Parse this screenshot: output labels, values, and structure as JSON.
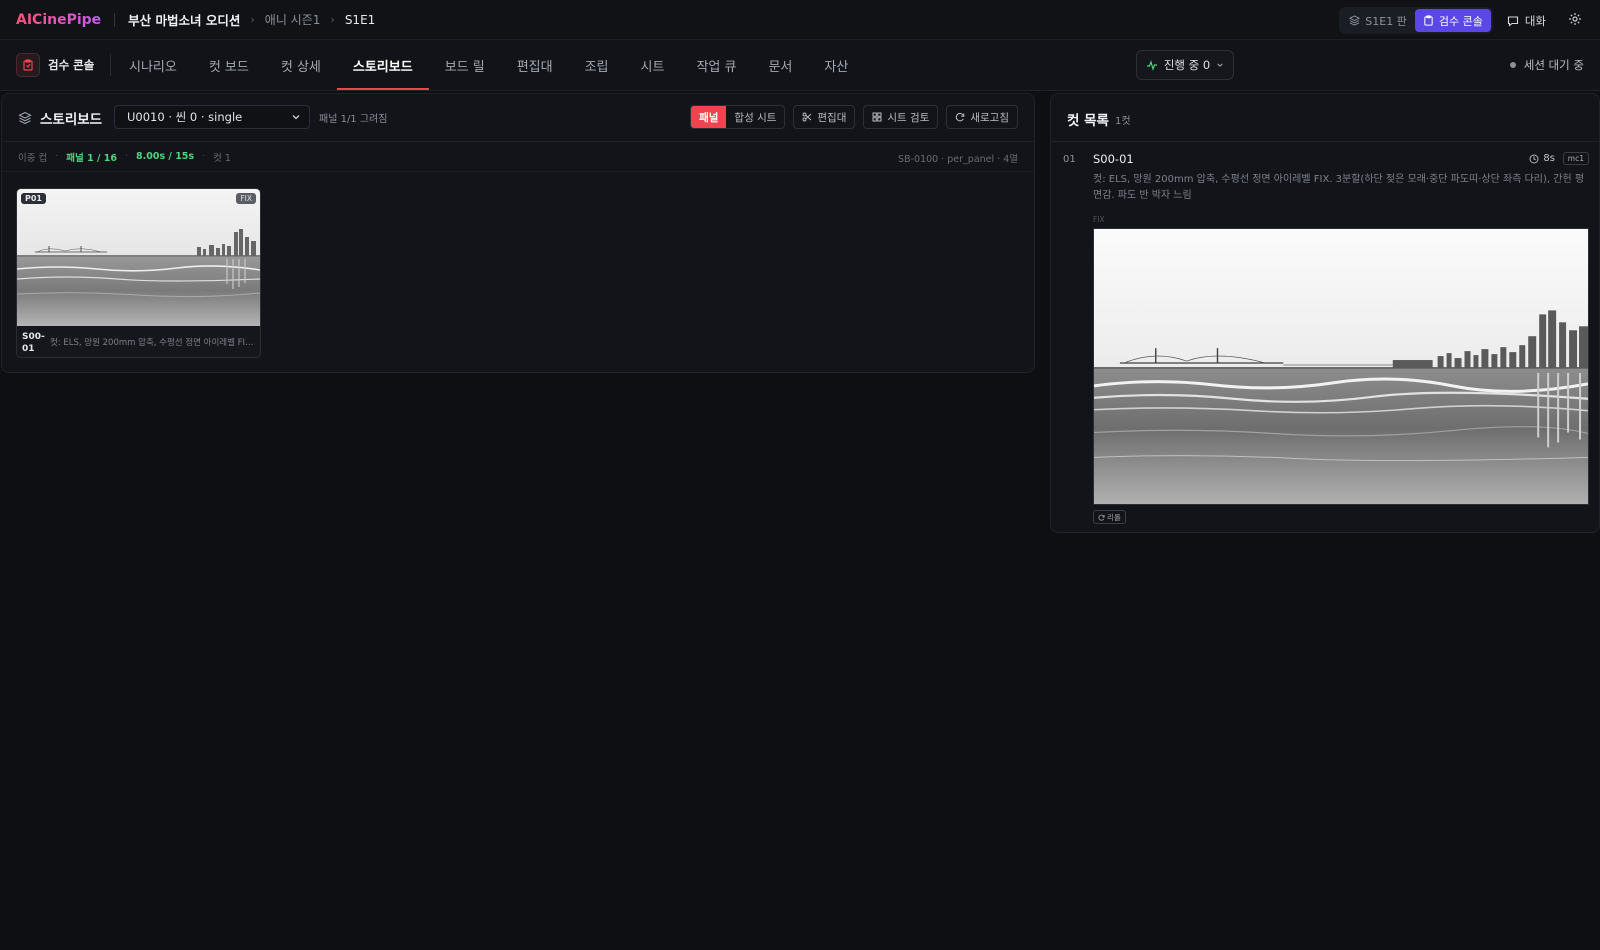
{
  "topbar": {
    "logo": "AICinePipe",
    "project": "부산 마법소녀 오디션",
    "breadcrumb": [
      "애니 시즌1",
      "S1E1"
    ],
    "episode_button": "S1E1 판",
    "review_button": "검수 콘솔",
    "chat_button": "대화"
  },
  "nav": {
    "review_console": "검수 콘솔",
    "tabs": [
      "시나리오",
      "컷 보드",
      "컷 상세",
      "스토리보드",
      "보드 릴",
      "편집대",
      "조립",
      "시트",
      "작업 큐",
      "문서",
      "자산"
    ],
    "active_tab": "스토리보드",
    "progress": "진행 중 0",
    "session_status": "세션 대기 중"
  },
  "storyboard": {
    "title": "스토리보드",
    "unit_select": "U0010 · 씬 0 · single",
    "panel_count": "패널 1/1 그려짐",
    "view_toggle": [
      "패널",
      "합성 시트"
    ],
    "buttons": {
      "editor": "편집대",
      "sheet_review": "시트 검토",
      "refresh": "새로고침"
    },
    "meta": {
      "label": "이중 컵",
      "panels": "패널 1 / 16",
      "duration": "8.00s / 15s",
      "cuts": "컷 1",
      "right": "SB-0100 · per_panel · 4열"
    },
    "panel": {
      "badge": "P01",
      "fix": "FIX",
      "id": "S00-01",
      "desc": "컷: ELS, 망원 200mm 압축, 수평선 정면 아이레벨 FIX. 3분할(하단 젖은 모래·중단 파도띠·상단 좌측 다리), 간헌 평면감. 파도 반 박자 느림"
    }
  },
  "cutlist": {
    "title": "컷 목록",
    "count": "1컷",
    "row": {
      "num": "01",
      "title": "S00-01",
      "duration": "8s",
      "badge": "mc1",
      "desc": "컷: ELS, 망원 200mm 압축, 수평선 정면 아이레벨 FIX. 3분할(하단 젖은 모래·중단 파도띠·상단 좌측 다리), 간헌 평면감. 파도 반 박자 느림",
      "fix": "FIX",
      "regen": "리롤"
    }
  },
  "colors": {
    "accent_red": "#ef4450",
    "accent_purple": "#5b46e6",
    "status_green": "#4fd47c",
    "background": "#0d0f13"
  },
  "icons": [
    "layers-icon",
    "clipboard-icon",
    "chat-icon",
    "gear-icon",
    "activity-icon",
    "chevron-down-icon",
    "scissors-icon",
    "grid-icon",
    "refresh-icon",
    "clock-icon"
  ]
}
